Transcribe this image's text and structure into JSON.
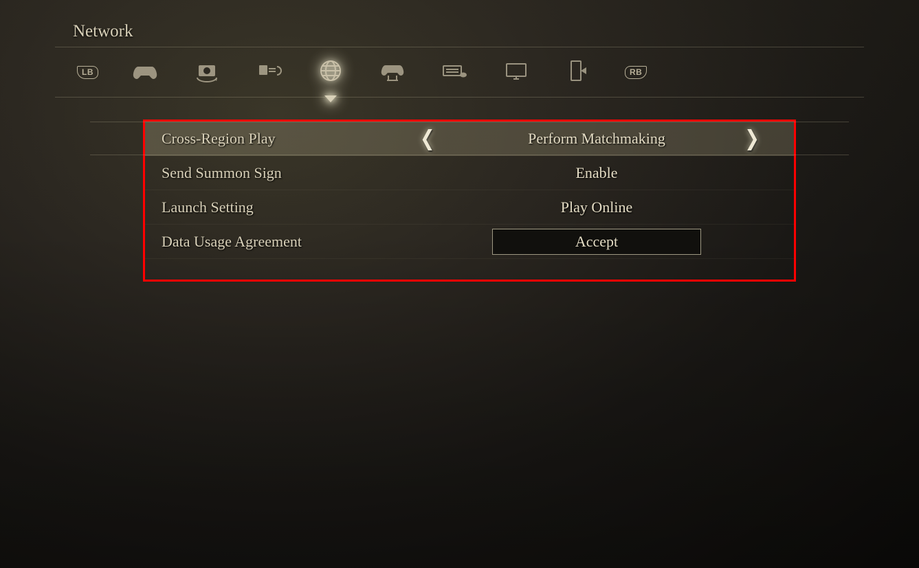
{
  "header": {
    "title": "Network"
  },
  "bumpers": {
    "left": "LB",
    "right": "RB"
  },
  "tabs": [
    {
      "name": "gameplay",
      "active": false
    },
    {
      "name": "camera",
      "active": false
    },
    {
      "name": "sound",
      "active": false
    },
    {
      "name": "network",
      "active": true
    },
    {
      "name": "controller",
      "active": false
    },
    {
      "name": "keyboard",
      "active": false
    },
    {
      "name": "display",
      "active": false
    },
    {
      "name": "quit",
      "active": false
    }
  ],
  "settings": {
    "rows": [
      {
        "label": "Cross-Region Play",
        "value": "Perform Matchmaking",
        "selected": true,
        "type": "selector"
      },
      {
        "label": "Send Summon Sign",
        "value": "Enable",
        "selected": false,
        "type": "selector"
      },
      {
        "label": "Launch Setting",
        "value": "Play Online",
        "selected": false,
        "type": "selector"
      },
      {
        "label": "Data Usage Agreement",
        "value": "Accept",
        "selected": false,
        "type": "button"
      }
    ]
  },
  "annotation": {
    "highlight_color": "#ff0000",
    "highlight_target": "settings-panel"
  }
}
